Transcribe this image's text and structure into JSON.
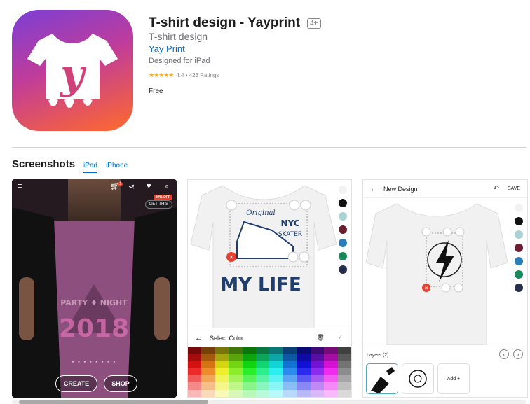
{
  "app": {
    "title": "T-shirt design - Yayprint",
    "age_rating": "4+",
    "subtitle": "T-shirt design",
    "developer": "Yay Print",
    "designed_for": "Designed for iPad",
    "stars": "★★★★★",
    "rating_text": "4.4 • 423 Ratings",
    "price": "Free",
    "icon": "yayprint-tshirt-logo"
  },
  "screenshots": {
    "title": "Screenshots",
    "tabs": [
      {
        "label": "iPad",
        "active": true
      },
      {
        "label": "iPhone",
        "active": false
      }
    ],
    "shot1": {
      "cart_count": "1",
      "promo": "20% OFF",
      "get_this": "GET THIS",
      "dots": "● ● ● ● ● ● ● ●",
      "create_label": "CREATE",
      "shop_label": "SHOP"
    },
    "shot2": {
      "select_color": "Select Color",
      "palette": [
        "#f2f2f2",
        "#111111",
        "#a9d3d6",
        "#6b1f30",
        "#2a7dbb",
        "#1a8a5a",
        "#26304d"
      ]
    },
    "shot3": {
      "title": "New Design",
      "save": "SAVE",
      "layers": "Layers (2)",
      "add": "Add +",
      "palette": [
        "#f2f2f2",
        "#111111",
        "#a9d3d6",
        "#6b1f30",
        "#2a7dbb",
        "#1a8a5a",
        "#26304d"
      ]
    }
  },
  "colors": {
    "link": "#0070c9",
    "icon_gradient": [
      "#7b3fd6",
      "#c03c9a",
      "#ff6a2b"
    ],
    "star": "#f5a623"
  }
}
